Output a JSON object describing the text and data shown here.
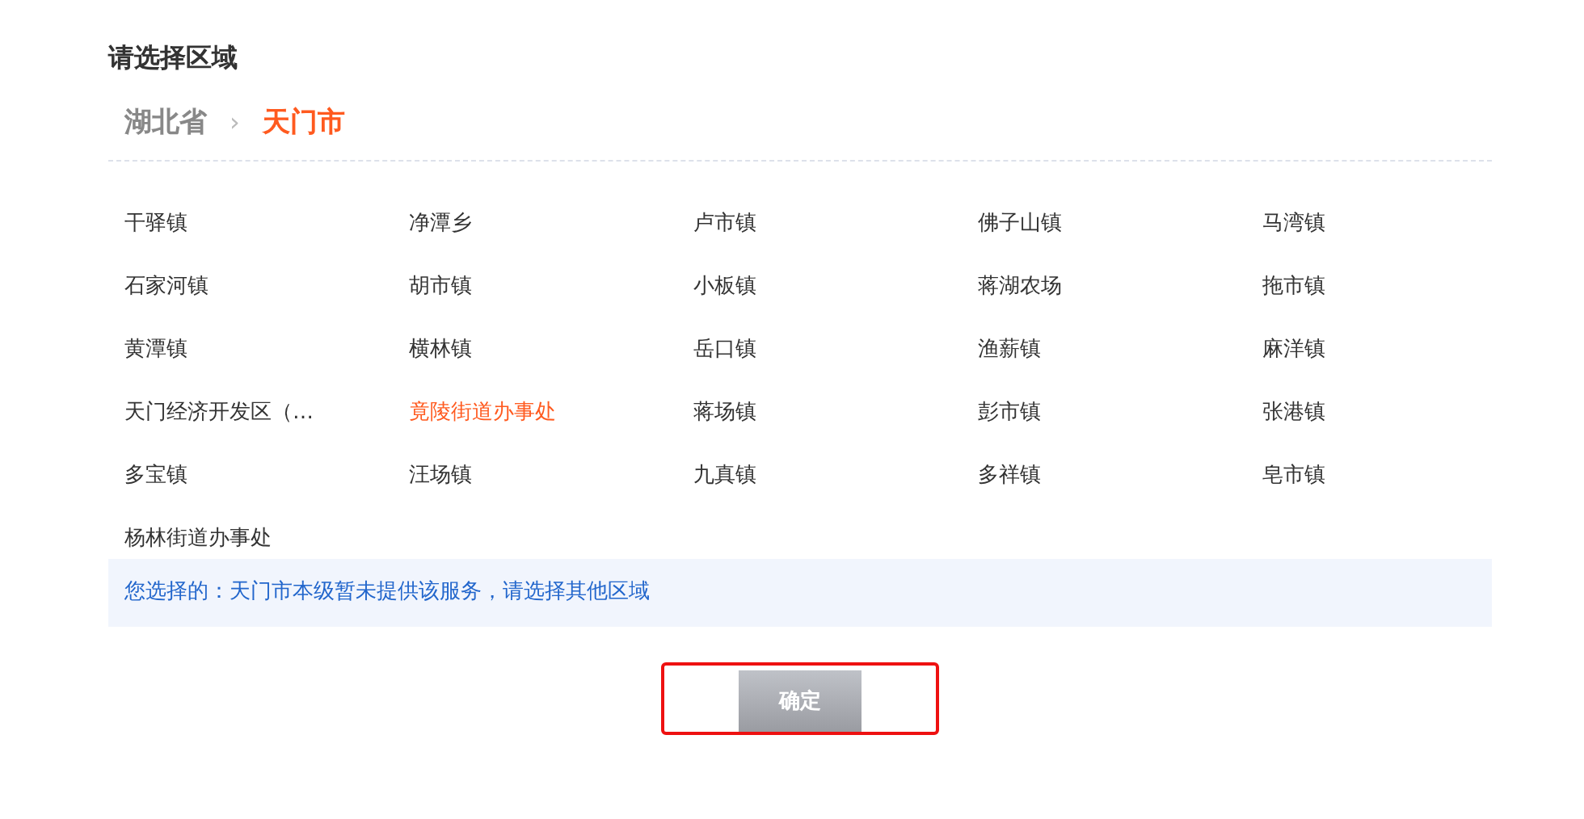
{
  "title": "请选择区域",
  "breadcrumb": [
    {
      "label": "湖北省",
      "selected": false
    },
    {
      "label": "天门市",
      "selected": true
    }
  ],
  "separator": "›",
  "regions": [
    {
      "label": "干驿镇",
      "selected": false
    },
    {
      "label": "净潭乡",
      "selected": false
    },
    {
      "label": "卢市镇",
      "selected": false
    },
    {
      "label": "佛子山镇",
      "selected": false
    },
    {
      "label": "马湾镇",
      "selected": false
    },
    {
      "label": "石家河镇",
      "selected": false
    },
    {
      "label": "胡市镇",
      "selected": false
    },
    {
      "label": "小板镇",
      "selected": false
    },
    {
      "label": "蒋湖农场",
      "selected": false
    },
    {
      "label": "拖市镇",
      "selected": false
    },
    {
      "label": "黄潭镇",
      "selected": false
    },
    {
      "label": "横林镇",
      "selected": false
    },
    {
      "label": "岳口镇",
      "selected": false
    },
    {
      "label": "渔薪镇",
      "selected": false
    },
    {
      "label": "麻洋镇",
      "selected": false
    },
    {
      "label": "天门经济开发区（…",
      "selected": false
    },
    {
      "label": "竟陵街道办事处",
      "selected": true
    },
    {
      "label": "蒋场镇",
      "selected": false
    },
    {
      "label": "彭市镇",
      "selected": false
    },
    {
      "label": "张港镇",
      "selected": false
    },
    {
      "label": "多宝镇",
      "selected": false
    },
    {
      "label": "汪场镇",
      "selected": false
    },
    {
      "label": "九真镇",
      "selected": false
    },
    {
      "label": "多祥镇",
      "selected": false
    },
    {
      "label": "皂市镇",
      "selected": false
    },
    {
      "label": "杨林街道办事处",
      "selected": false
    }
  ],
  "notice": "您选择的：天门市本级暂未提供该服务，请选择其他区域",
  "confirm_button": {
    "label": "确定",
    "disabled": true
  }
}
